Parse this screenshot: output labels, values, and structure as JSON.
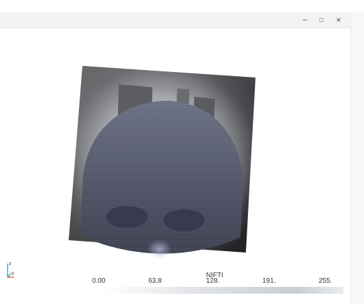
{
  "window": {
    "minimize_glyph": "–",
    "maximize_glyph": "□",
    "close_glyph": "×"
  },
  "colorbar": {
    "title": "NIFTI",
    "ticks": [
      "0.00",
      "63.8",
      "128.",
      "191.",
      "255."
    ]
  },
  "orientation_axes": {
    "labels": [
      "z",
      "y"
    ]
  },
  "icons": [
    "minimize-icon",
    "maximize-icon",
    "close-icon",
    "orientation-axes-icon"
  ]
}
